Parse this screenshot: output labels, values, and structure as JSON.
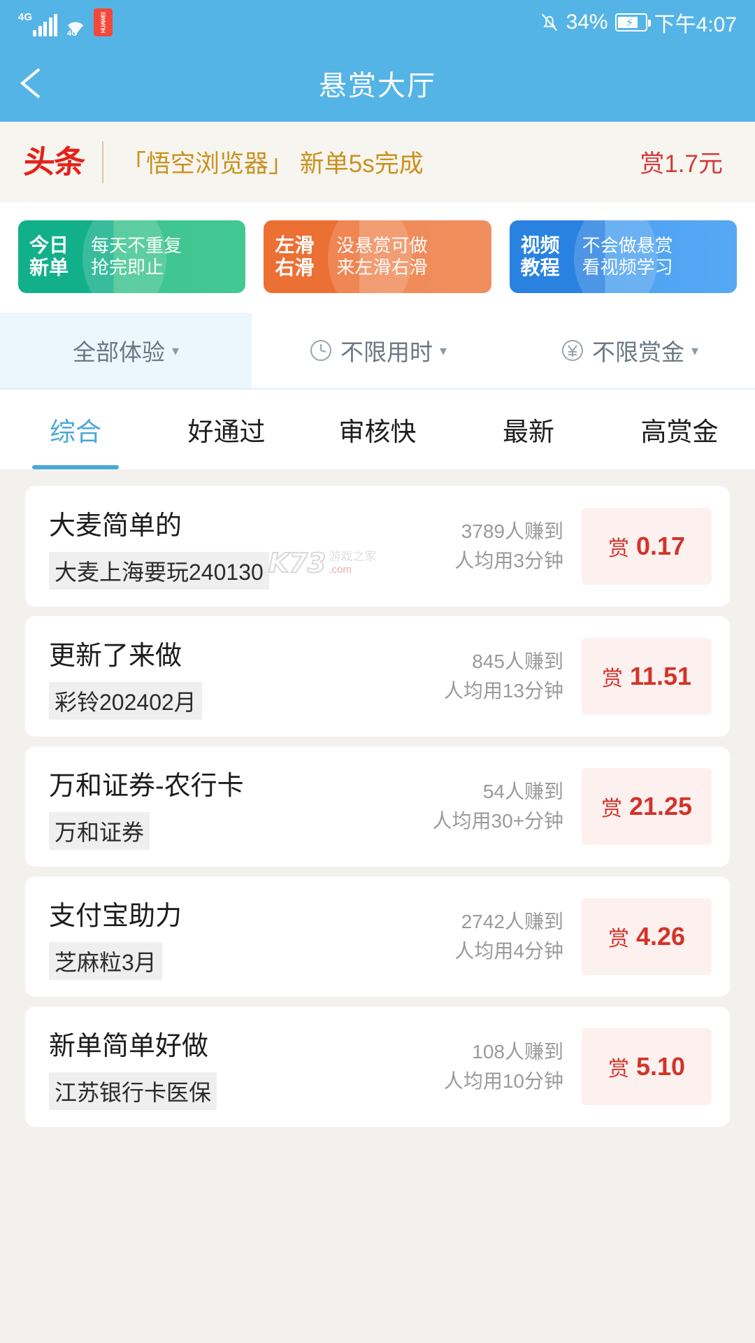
{
  "statusbar": {
    "network_label": "4G",
    "wifi_sub": "4G",
    "carrier_badge": "HUAWEI",
    "battery_percent": "34%",
    "time": "下午4:07",
    "mute_icon": "bell-muted-icon",
    "battery_icon": "battery-charging-icon"
  },
  "appbar": {
    "back_icon": "back-arrow-icon",
    "title": "悬赏大厅"
  },
  "headline": {
    "logo": "头条",
    "text": "「悟空浏览器」 新单5s完成",
    "reward": "赏1.7元"
  },
  "promos": [
    {
      "badge_line1": "今日",
      "badge_line2": "新单",
      "desc_line1": "每天不重复",
      "desc_line2": "抢完即止",
      "color": "#12b08a"
    },
    {
      "badge_line1": "左滑",
      "badge_line2": "右滑",
      "desc_line1": "没悬赏可做",
      "desc_line2": "来左滑右滑",
      "color": "#ec6f33"
    },
    {
      "badge_line1": "视频",
      "badge_line2": "教程",
      "desc_line1": "不会做悬赏",
      "desc_line2": "看视频学习",
      "color": "#2a82e0"
    }
  ],
  "filters": [
    {
      "label": "全部体验",
      "icon": "",
      "active": true
    },
    {
      "label": "不限用时",
      "icon": "clock-icon",
      "active": false
    },
    {
      "label": "不限赏金",
      "icon": "yen-icon",
      "active": false
    }
  ],
  "caret": "▾",
  "tabs": [
    {
      "label": "综合",
      "active": true
    },
    {
      "label": "好通过",
      "active": false
    },
    {
      "label": "审核快",
      "active": false
    },
    {
      "label": "最新",
      "active": false
    },
    {
      "label": "高赏金",
      "active": false
    }
  ],
  "tasks": [
    {
      "title": "大麦简单的",
      "tag": "大麦上海要玩240130",
      "earners": "3789人赚到",
      "duration": "人均用3分钟",
      "reward_label": "赏",
      "reward_value": "0.17"
    },
    {
      "title": "更新了来做",
      "tag": "彩铃202402月",
      "earners": "845人赚到",
      "duration": "人均用13分钟",
      "reward_label": "赏",
      "reward_value": "11.51"
    },
    {
      "title": "万和证券-农行卡",
      "tag": "万和证券",
      "earners": "54人赚到",
      "duration": "人均用30+分钟",
      "reward_label": "赏",
      "reward_value": "21.25"
    },
    {
      "title": "支付宝助力",
      "tag": "芝麻粒3月",
      "earners": "2742人赚到",
      "duration": "人均用4分钟",
      "reward_label": "赏",
      "reward_value": "4.26"
    },
    {
      "title": "新单简单好做",
      "tag": "江苏银行卡医保",
      "earners": "108人赚到",
      "duration": "人均用10分钟",
      "reward_label": "赏",
      "reward_value": "5.10"
    }
  ],
  "watermark": {
    "main": "K73",
    "cn": "游戏之家",
    "com": ".com"
  },
  "colors": {
    "accent": "#55b4e6",
    "reward_red": "#d2342a",
    "headline_gold": "#c9921f",
    "headline_red": "#e2231a",
    "tab_active": "#4aa8d8"
  }
}
